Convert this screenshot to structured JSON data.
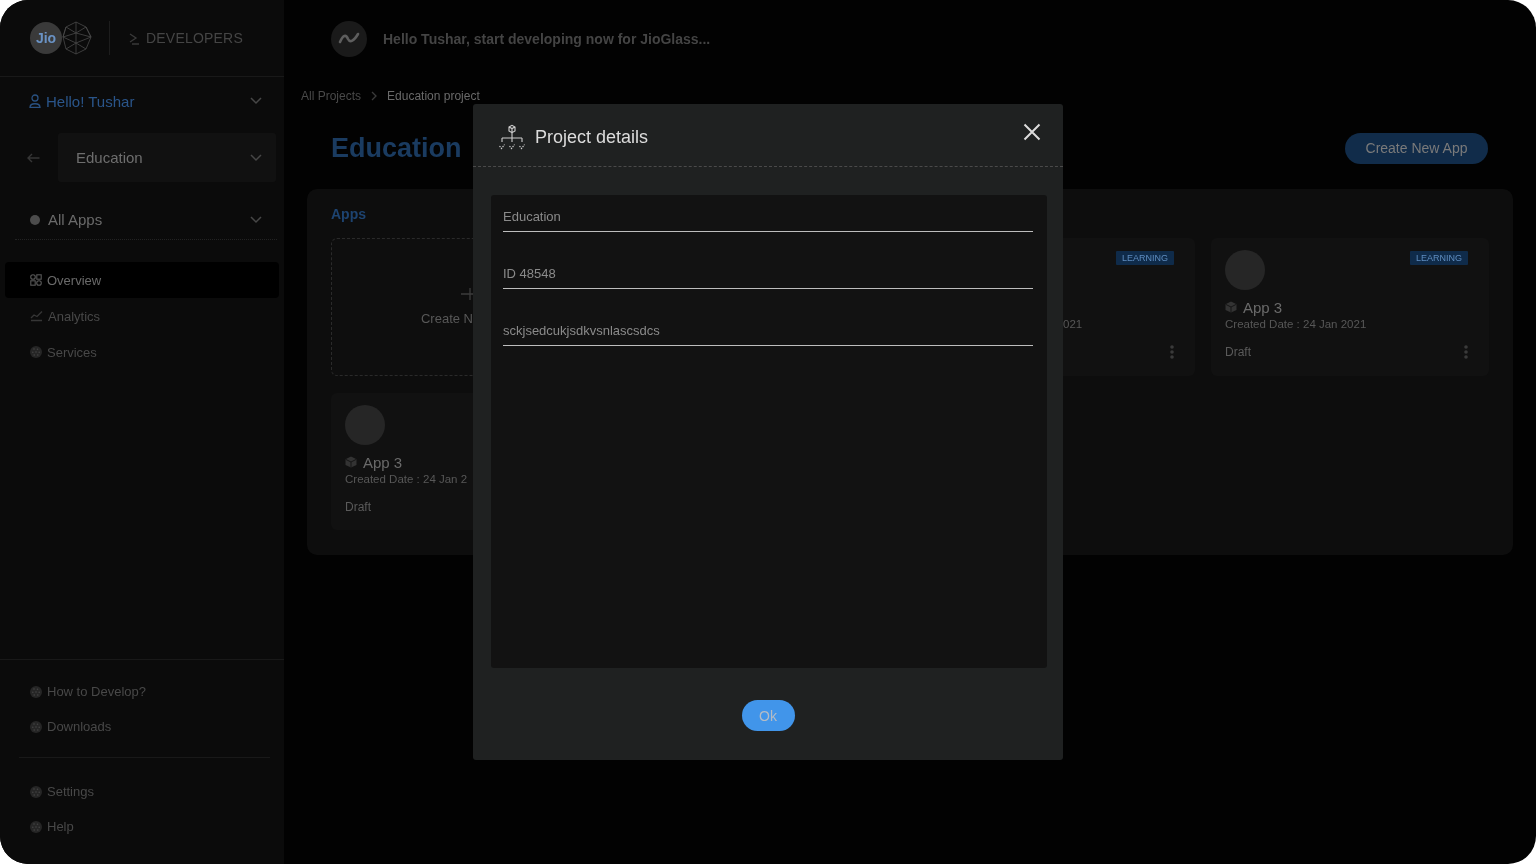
{
  "sidebar": {
    "brand": {
      "logo_text": "Jio",
      "section": "DEVELOPERS"
    },
    "user_menu": {
      "label": "Hello! Tushar"
    },
    "project_select": {
      "value": "Education"
    },
    "app_filter": {
      "label": "All Apps"
    },
    "nav_items": [
      {
        "label": "Overview",
        "selected": true
      },
      {
        "label": "Analytics",
        "selected": false
      },
      {
        "label": "Services",
        "selected": false
      }
    ],
    "resource_items": [
      {
        "label": "How to Develop?"
      },
      {
        "label": "Downloads"
      }
    ],
    "footer_items": [
      {
        "label": "Settings"
      },
      {
        "label": "Help"
      }
    ]
  },
  "header": {
    "greeting": "Hello Tushar, start developing now for JioGlass..."
  },
  "breadcrumb": [
    {
      "label": "All Projects",
      "current": false
    },
    {
      "label": "Education project",
      "current": true
    }
  ],
  "page_title": "Education",
  "create_button": "Create New App",
  "apps_panel": {
    "title": "Apps",
    "cards": [
      {
        "kind": "create",
        "label": "Create N"
      },
      {
        "kind": "app",
        "badge": "LEARNING",
        "date": "021"
      },
      {
        "kind": "app",
        "name": "App 3",
        "date": "Created Date : 24 Jan 2021",
        "status": "Draft",
        "badge": "LEARNING"
      },
      {
        "kind": "app",
        "name": "App 3",
        "date": "Created Date : 24 Jan 2",
        "status": "Draft"
      }
    ]
  },
  "dialog": {
    "title": "Project details",
    "fields": [
      {
        "value": "Education"
      },
      {
        "value": "ID 48548"
      },
      {
        "value": "sckjsedcukjsdkvsnlascsdcs"
      }
    ],
    "ok_button": "Ok"
  }
}
